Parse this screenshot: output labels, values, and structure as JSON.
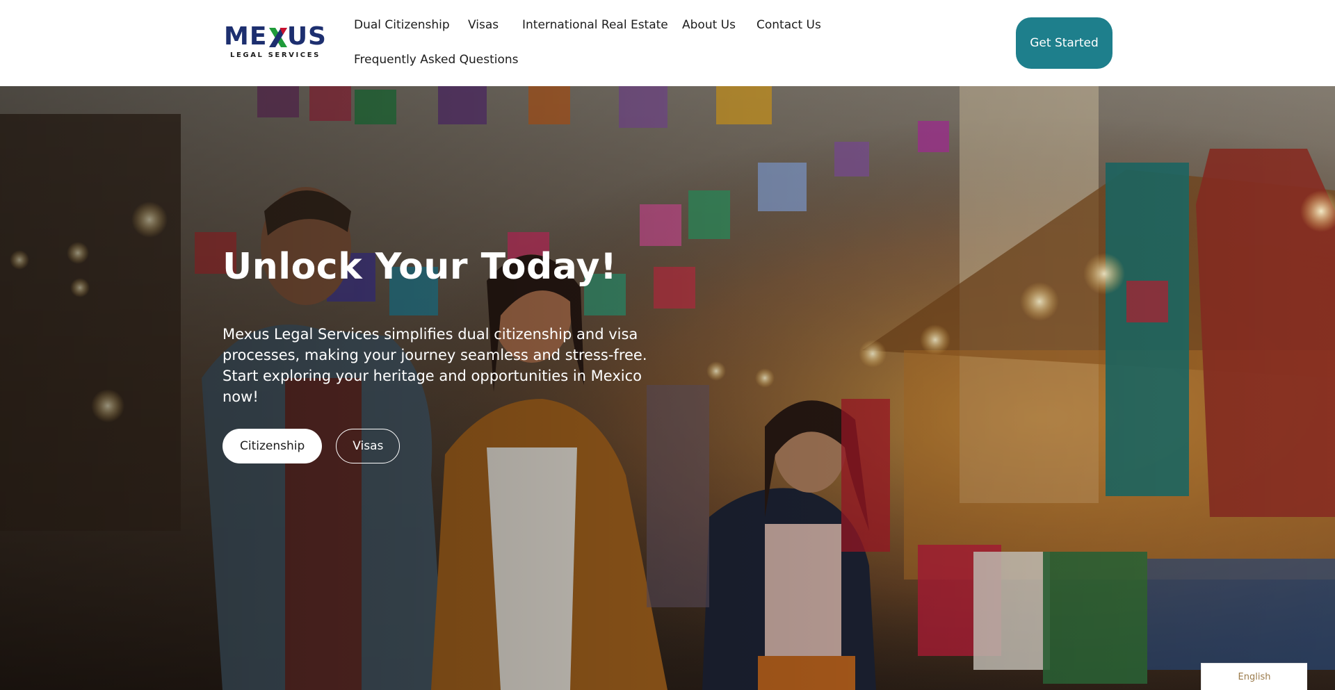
{
  "brand": {
    "logo_text_left": "ME",
    "logo_text_right": "US",
    "logo_subtitle": "LEGAL SERVICES",
    "colors": {
      "navy": "#1d2f6f",
      "green": "#1f9b3a",
      "red": "#c8102e"
    }
  },
  "nav": {
    "items": [
      {
        "label": "Dual Citizenship"
      },
      {
        "label": "Visas"
      },
      {
        "label": "International Real Estate"
      },
      {
        "label": "About Us"
      },
      {
        "label": "Contact Us"
      },
      {
        "label": "Frequently Asked Questions"
      }
    ],
    "cta_label": "Get Started",
    "cta_color": "#1e7f8c"
  },
  "hero": {
    "title": "Unlock Your  Today!",
    "description": "Mexus Legal Services simplifies dual citizenship and visa processes, making your journey seamless and stress-free. Start exploring your heritage and opportunities in Mexico now!",
    "primary_button": "Citizenship",
    "secondary_button": "Visas",
    "image_description_icon": "family-market-photo"
  },
  "language": {
    "selected": "English"
  }
}
